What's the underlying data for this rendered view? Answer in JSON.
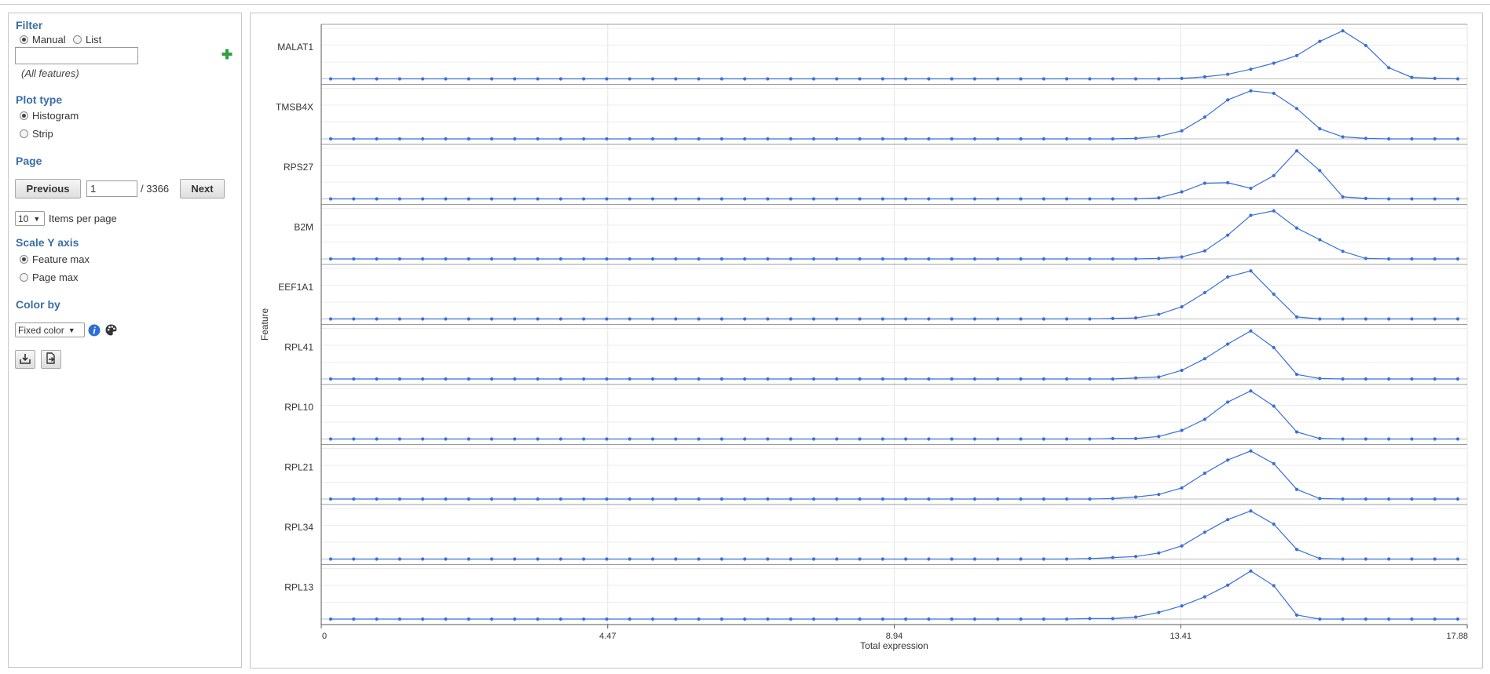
{
  "filter": {
    "title": "Filter",
    "mode_manual": "Manual",
    "mode_list": "List",
    "input_value": "",
    "hint": "(All features)"
  },
  "plot_type": {
    "title": "Plot type",
    "histogram": "Histogram",
    "strip": "Strip"
  },
  "page": {
    "title": "Page",
    "previous_label": "Previous",
    "current": "1",
    "total": "/ 3366",
    "next_label": "Next",
    "items_per_page": "10",
    "items_label": "Items per page"
  },
  "scale_y": {
    "title": "Scale Y axis",
    "feature_max": "Feature max",
    "page_max": "Page max"
  },
  "color_by": {
    "title": "Color by",
    "value": "Fixed color"
  },
  "colors": {
    "accent": "#3a6ea5",
    "series": "#3a6fd8",
    "add": "#2ea043",
    "info": "#2a6fd6"
  },
  "chart_data": {
    "type": "line",
    "xlabel": "Total expression",
    "ylabel": "Feature",
    "xlim": [
      0,
      17.88
    ],
    "xticks": [
      "0",
      "4.47",
      "8.94",
      "13.41",
      "17.88"
    ],
    "xtick_values": [
      0,
      4.47,
      8.94,
      13.41,
      17.88
    ],
    "grid": true,
    "bin_count": 50,
    "series": [
      {
        "name": "MALAT1",
        "values": [
          0,
          0,
          0,
          0,
          0,
          0,
          0,
          0,
          0,
          0,
          0,
          0,
          0,
          0,
          0,
          0,
          0,
          0,
          0,
          0,
          0,
          0,
          0,
          0,
          0,
          0,
          0,
          0,
          0,
          0,
          0,
          0,
          0,
          0,
          0,
          0,
          0,
          0.01,
          0.04,
          0.09,
          0.19,
          0.31,
          0.46,
          0.74,
          0.95,
          0.66,
          0.22,
          0.03,
          0.01,
          0
        ]
      },
      {
        "name": "TMSB4X",
        "values": [
          0,
          0,
          0,
          0,
          0,
          0,
          0,
          0,
          0,
          0,
          0,
          0,
          0,
          0,
          0,
          0,
          0,
          0,
          0,
          0,
          0,
          0,
          0,
          0,
          0,
          0,
          0,
          0,
          0,
          0,
          0,
          0,
          0,
          0,
          0,
          0.01,
          0.05,
          0.16,
          0.43,
          0.77,
          0.95,
          0.9,
          0.6,
          0.2,
          0.04,
          0.01,
          0,
          0,
          0,
          0
        ]
      },
      {
        "name": "RPS27",
        "values": [
          0,
          0,
          0,
          0,
          0,
          0,
          0,
          0,
          0,
          0,
          0,
          0,
          0,
          0,
          0,
          0,
          0,
          0,
          0,
          0,
          0,
          0,
          0,
          0,
          0,
          0,
          0,
          0,
          0,
          0,
          0,
          0,
          0,
          0,
          0,
          0,
          0.02,
          0.14,
          0.31,
          0.32,
          0.21,
          0.46,
          0.95,
          0.56,
          0.04,
          0.01,
          0,
          0,
          0,
          0
        ]
      },
      {
        "name": "B2M",
        "values": [
          0,
          0,
          0,
          0,
          0,
          0,
          0,
          0,
          0,
          0,
          0,
          0,
          0,
          0,
          0,
          0,
          0,
          0,
          0,
          0,
          0,
          0,
          0,
          0,
          0,
          0,
          0,
          0,
          0,
          0,
          0,
          0,
          0,
          0,
          0,
          0,
          0.01,
          0.04,
          0.16,
          0.47,
          0.86,
          0.95,
          0.61,
          0.38,
          0.15,
          0.01,
          0,
          0,
          0,
          0
        ]
      },
      {
        "name": "EEF1A1",
        "values": [
          0,
          0,
          0,
          0,
          0,
          0,
          0,
          0,
          0,
          0,
          0,
          0,
          0,
          0,
          0,
          0,
          0,
          0,
          0,
          0,
          0,
          0,
          0,
          0,
          0,
          0,
          0,
          0,
          0,
          0,
          0,
          0,
          0,
          0,
          0.01,
          0.02,
          0.09,
          0.24,
          0.52,
          0.83,
          0.95,
          0.49,
          0.04,
          0,
          0,
          0,
          0,
          0,
          0,
          0
        ]
      },
      {
        "name": "RPL41",
        "values": [
          0,
          0,
          0,
          0,
          0,
          0,
          0,
          0,
          0,
          0,
          0,
          0,
          0,
          0,
          0,
          0,
          0,
          0,
          0,
          0,
          0,
          0,
          0,
          0,
          0,
          0,
          0,
          0,
          0,
          0,
          0,
          0,
          0,
          0,
          0,
          0.02,
          0.04,
          0.17,
          0.4,
          0.69,
          0.95,
          0.62,
          0.09,
          0.01,
          0,
          0,
          0,
          0,
          0,
          0
        ]
      },
      {
        "name": "RPL10",
        "values": [
          0,
          0,
          0,
          0,
          0,
          0,
          0,
          0,
          0,
          0,
          0,
          0,
          0,
          0,
          0,
          0,
          0,
          0,
          0,
          0,
          0,
          0,
          0,
          0,
          0,
          0,
          0,
          0,
          0,
          0,
          0,
          0,
          0,
          0,
          0.01,
          0.01,
          0.05,
          0.17,
          0.39,
          0.73,
          0.95,
          0.65,
          0.14,
          0.01,
          0,
          0,
          0,
          0,
          0,
          0
        ]
      },
      {
        "name": "RPL21",
        "values": [
          0,
          0,
          0,
          0,
          0,
          0,
          0,
          0,
          0,
          0,
          0,
          0,
          0,
          0,
          0,
          0,
          0,
          0,
          0,
          0,
          0,
          0,
          0,
          0,
          0,
          0,
          0,
          0,
          0,
          0,
          0,
          0,
          0,
          0,
          0.01,
          0.04,
          0.09,
          0.22,
          0.51,
          0.77,
          0.95,
          0.7,
          0.19,
          0.01,
          0,
          0,
          0,
          0,
          0,
          0
        ]
      },
      {
        "name": "RPL34",
        "values": [
          0,
          0,
          0,
          0,
          0,
          0,
          0,
          0,
          0,
          0,
          0,
          0,
          0,
          0,
          0,
          0,
          0,
          0,
          0,
          0,
          0,
          0,
          0,
          0,
          0,
          0,
          0,
          0,
          0,
          0,
          0,
          0,
          0,
          0.01,
          0.03,
          0.05,
          0.12,
          0.26,
          0.53,
          0.78,
          0.95,
          0.69,
          0.19,
          0.01,
          0,
          0,
          0,
          0,
          0,
          0
        ]
      },
      {
        "name": "RPL13",
        "values": [
          0,
          0,
          0,
          0,
          0,
          0,
          0,
          0,
          0,
          0,
          0,
          0,
          0,
          0,
          0,
          0,
          0,
          0,
          0,
          0,
          0,
          0,
          0,
          0,
          0,
          0,
          0,
          0,
          0,
          0,
          0,
          0,
          0,
          0.01,
          0.01,
          0.04,
          0.13,
          0.26,
          0.44,
          0.67,
          0.95,
          0.66,
          0.08,
          0,
          0,
          0,
          0,
          0,
          0,
          0
        ]
      }
    ]
  }
}
